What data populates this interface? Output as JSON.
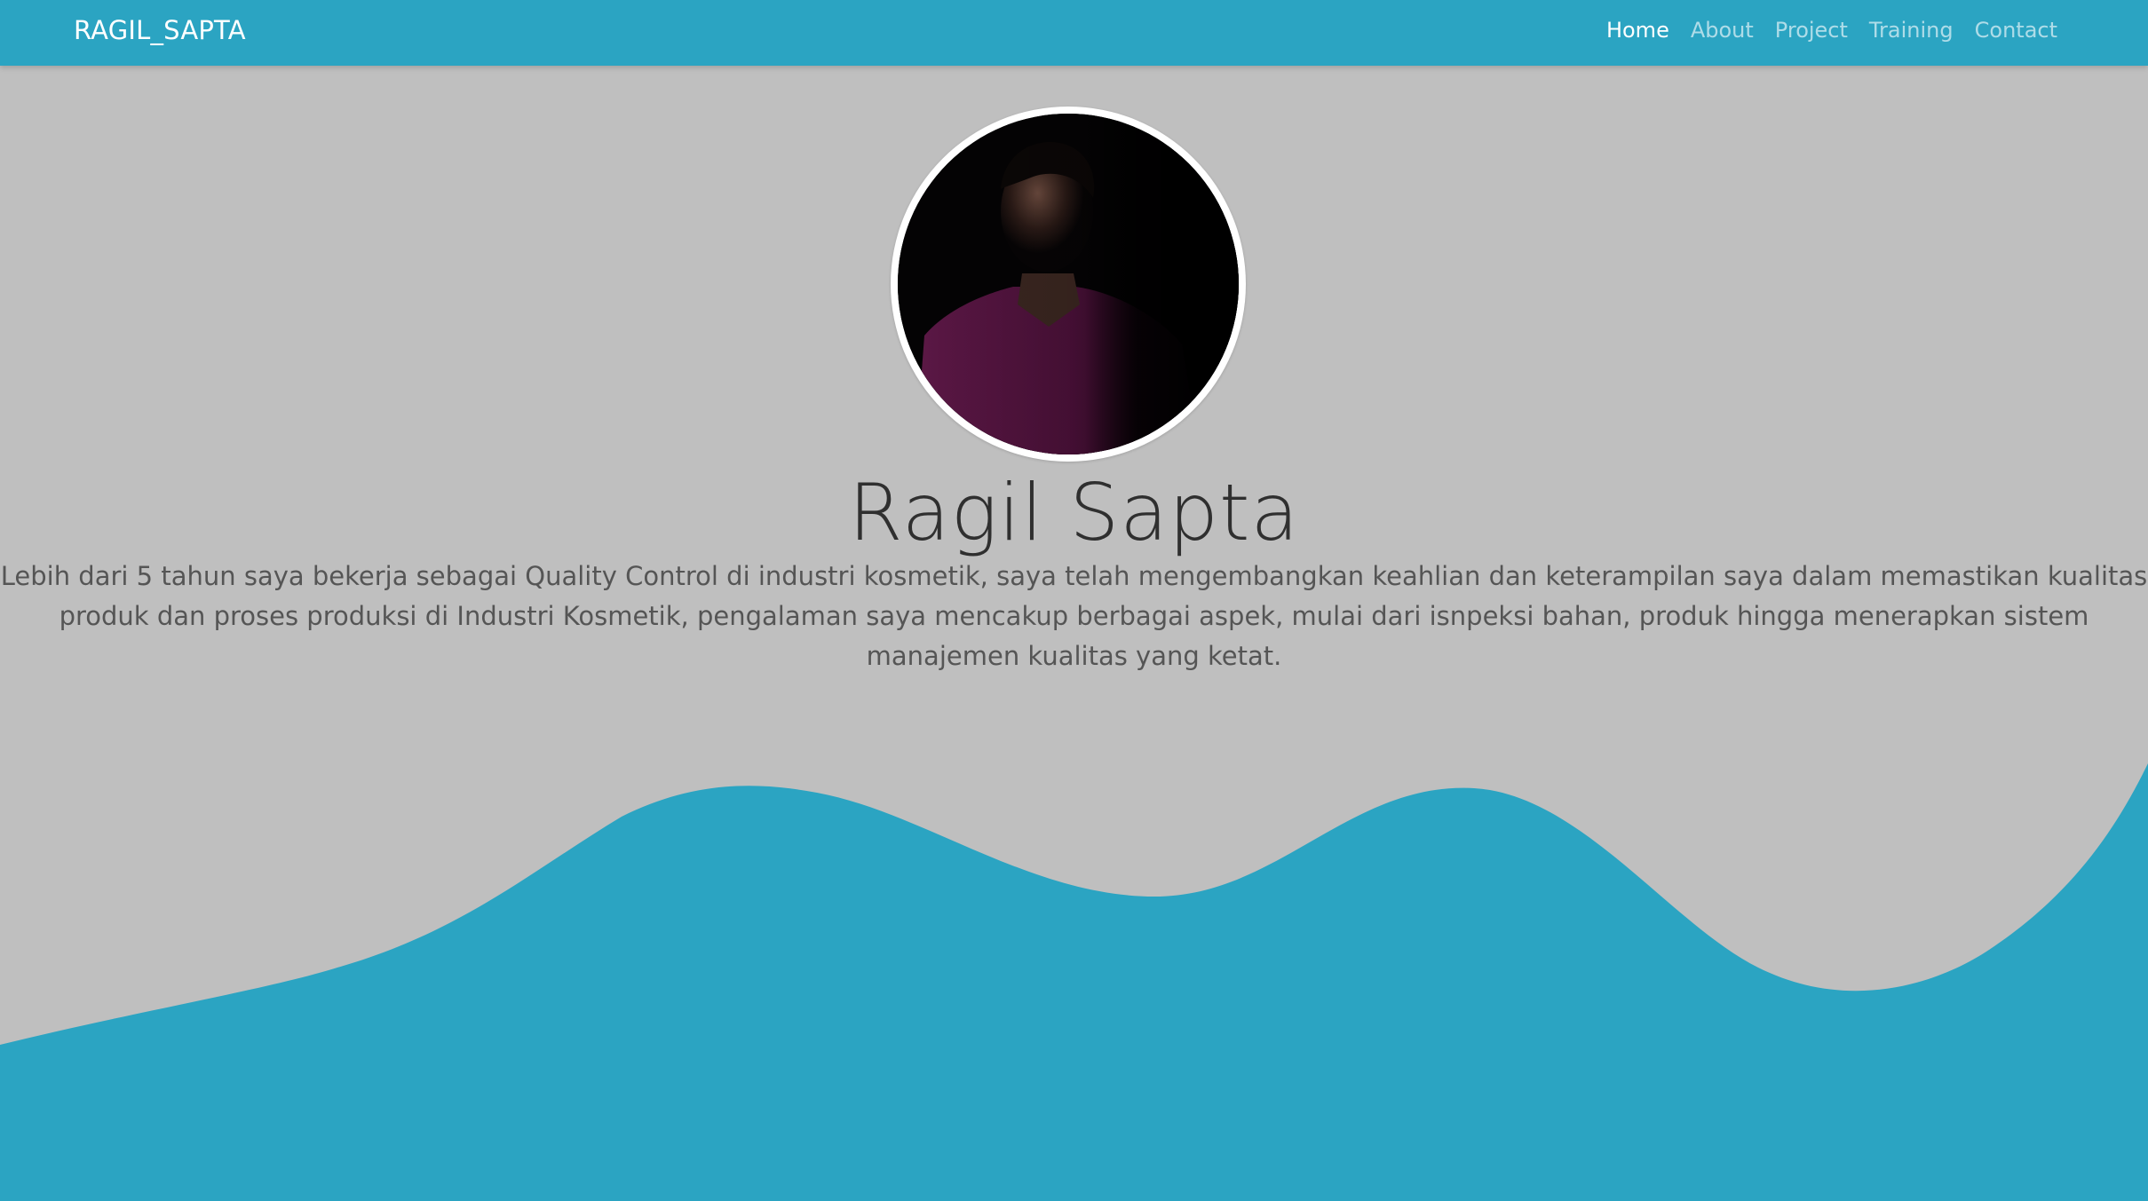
{
  "navbar": {
    "brand": "RAGIL_SAPTA",
    "links": [
      {
        "label": "Home",
        "active": true
      },
      {
        "label": "About",
        "active": false
      },
      {
        "label": "Project",
        "active": false
      },
      {
        "label": "Training",
        "active": false
      },
      {
        "label": "Contact",
        "active": false
      }
    ]
  },
  "hero": {
    "name": "Ragil Sapta",
    "bio": "Lebih dari 5 tahun saya bekerja sebagai Quality Control di industri kosmetik, saya telah mengembangkan keahlian dan keterampilan saya dalam memastikan kualitas produk dan proses produksi di Industri Kosmetik, pengalaman saya mencakup berbagai aspek, mulai dari isnpeksi bahan, produk hingga menerapkan sistem manajemen kualitas yang ketat."
  },
  "colors": {
    "primary": "#2ba4c2",
    "background": "#bfbfbf",
    "text": "#2f2f2f"
  }
}
